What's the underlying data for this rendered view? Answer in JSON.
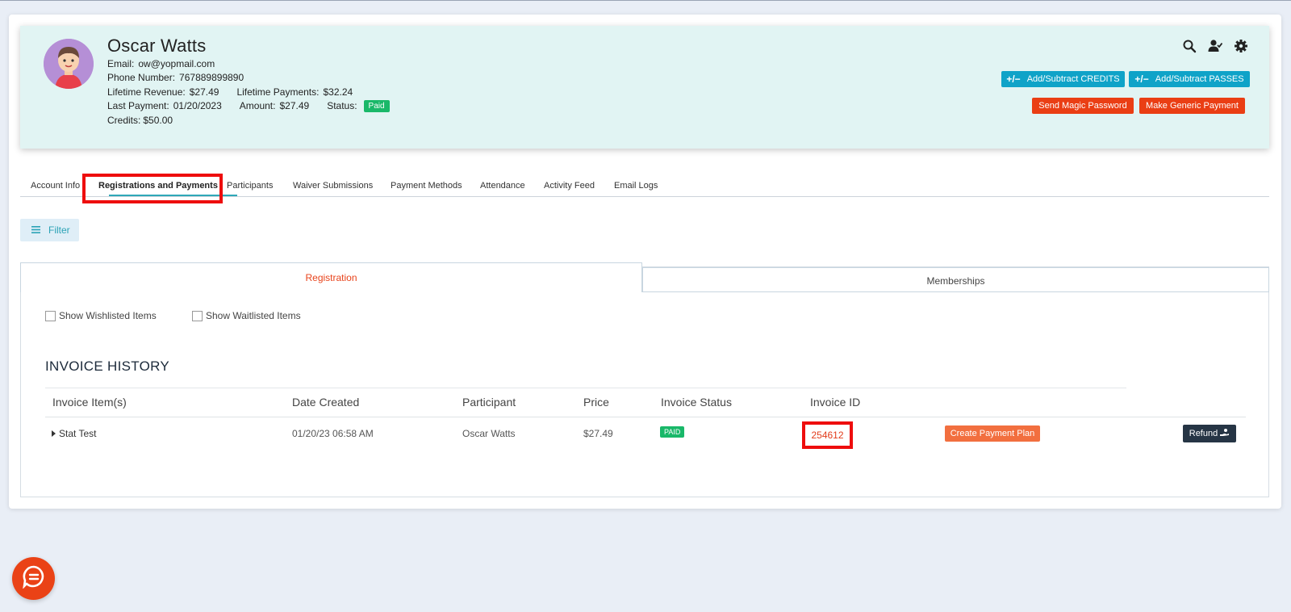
{
  "profile": {
    "name": "Oscar Watts",
    "email_label": "Email:",
    "email": "ow@yopmail.com",
    "phone_label": "Phone Number:",
    "phone": "767889899890",
    "lifetime_revenue_label": "Lifetime Revenue:",
    "lifetime_revenue": "$27.49",
    "lifetime_payments_label": "Lifetime Payments:",
    "lifetime_payments": "$32.24",
    "last_payment_label": "Last Payment:",
    "last_payment": "01/20/2023",
    "amount_label": "Amount:",
    "amount": "$27.49",
    "status_label": "Status:",
    "status": "Paid",
    "credits_label": "Credits:",
    "credits": "$50.00"
  },
  "header_icons": [
    "search-icon",
    "user-check-icon",
    "gear-icon"
  ],
  "buttons": {
    "add_credits": "Add/Subtract CREDITS",
    "add_passes": "Add/Subtract PASSES",
    "plus_minus": "+/−",
    "send_magic": "Send Magic Password",
    "generic_payment": "Make Generic Payment"
  },
  "tabs": [
    {
      "label": "Account Info"
    },
    {
      "label": "Registrations and Payments",
      "active": true
    },
    {
      "label": "Participants"
    },
    {
      "label": "Waiver Submissions"
    },
    {
      "label": "Payment Methods"
    },
    {
      "label": "Attendance"
    },
    {
      "label": "Activity Feed"
    },
    {
      "label": "Email Logs"
    }
  ],
  "filter": {
    "label": "Filter"
  },
  "subtabs": {
    "registration": "Registration",
    "memberships": "Memberships"
  },
  "checkboxes": {
    "wishlisted": "Show Wishlisted Items",
    "waitlisted": "Show Waitlisted Items"
  },
  "invoice": {
    "title": "INVOICE HISTORY",
    "columns": [
      "Invoice Item(s)",
      "Date Created",
      "Participant",
      "Price",
      "Invoice Status",
      "Invoice ID"
    ],
    "rows": [
      {
        "item": "Stat Test",
        "date": "01/20/23 06:58 AM",
        "participant": "Oscar Watts",
        "price": "$27.49",
        "status": "PAID",
        "invoice_id": "254612",
        "plan_button": "Create Payment Plan",
        "refund_button": "Refund"
      }
    ]
  },
  "colors": {
    "profile_bg": "#e1f4f3",
    "accent_blue": "#0fa3c8",
    "accent_red": "#ea3e14",
    "paid_green": "#19b869",
    "highlight": "#ee0d0d",
    "refund_dark": "#263545"
  }
}
